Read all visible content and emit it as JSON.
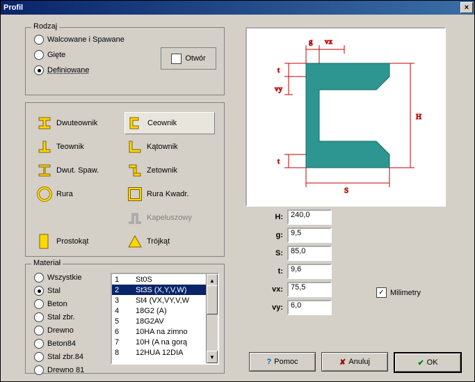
{
  "window": {
    "title": "Profil",
    "close_tooltip": "Close"
  },
  "rodzaj": {
    "legend": "Rodzaj",
    "options": {
      "walcowane": "Walcowane i Spawane",
      "giete": "Gięte",
      "definiowane": "Definiowane"
    },
    "selected": "definiowane",
    "otwor_label": "Otwór",
    "otwor_checked": false
  },
  "shapes": {
    "items": [
      {
        "id": "dwuteownik",
        "label": "Dwuteownik"
      },
      {
        "id": "ceownik",
        "label": "Ceownik"
      },
      {
        "id": "teownik",
        "label": "Teownik"
      },
      {
        "id": "katownik",
        "label": "Kątownik"
      },
      {
        "id": "dwut_spaw",
        "label": "Dwut. Spaw."
      },
      {
        "id": "zetownik",
        "label": "Zetownik"
      },
      {
        "id": "rura",
        "label": "Rura"
      },
      {
        "id": "rura_kwadr",
        "label": "Rura Kwadr."
      },
      {
        "id": "blank",
        "label": ""
      },
      {
        "id": "kapeluszowy",
        "label": "Kapeluszowy",
        "disabled": true
      },
      {
        "id": "prostokat",
        "label": "Prostokąt"
      },
      {
        "id": "trojkat",
        "label": "Trójkąt"
      }
    ],
    "selected": "ceownik"
  },
  "material": {
    "legend": "Materiał",
    "options": {
      "wszystkie": "Wszystkie",
      "stal": "Stal",
      "beton": "Beton",
      "stal_zbr": "Stal zbr.",
      "drewno": "Drewno",
      "beton84": "Beton84",
      "stal_zbr84": "Stal zbr.84",
      "drewno81": "Drewno 81"
    },
    "selected": "stal",
    "list": [
      {
        "idx": "1",
        "name": "St0S"
      },
      {
        "idx": "2",
        "name": "St3S (X,Y,V,W)"
      },
      {
        "idx": "3",
        "name": "St4 (VX,VY,V,W"
      },
      {
        "idx": "4",
        "name": "18G2 (A)"
      },
      {
        "idx": "5",
        "name": "18G2AV"
      },
      {
        "idx": "6",
        "name": "10HA na zimno"
      },
      {
        "idx": "7",
        "name": "10H (A na gorą"
      },
      {
        "idx": "8",
        "name": "12HUA 12DIA"
      }
    ],
    "list_selected_idx": "2"
  },
  "diagram": {
    "labels": {
      "g": "g",
      "vx": "vx",
      "t_top": "t",
      "vy": "vy",
      "t_bot": "t",
      "H": "H",
      "S": "S"
    },
    "colors": {
      "fill": "#2d9690",
      "line_red": "#c00000"
    }
  },
  "dimensions": {
    "rows": [
      {
        "label": "H:",
        "value": "240,0"
      },
      {
        "label": "g:",
        "value": "9,5"
      },
      {
        "label": "S:",
        "value": "85,0"
      },
      {
        "label": "t:",
        "value": "9,6"
      },
      {
        "label": "vx:",
        "value": "75,5"
      },
      {
        "label": "vy:",
        "value": "6,0"
      }
    ],
    "mm_label": "Milimetry",
    "mm_checked": true
  },
  "buttons": {
    "help": "Pomoc",
    "cancel": "Anuluj",
    "ok": "OK"
  }
}
